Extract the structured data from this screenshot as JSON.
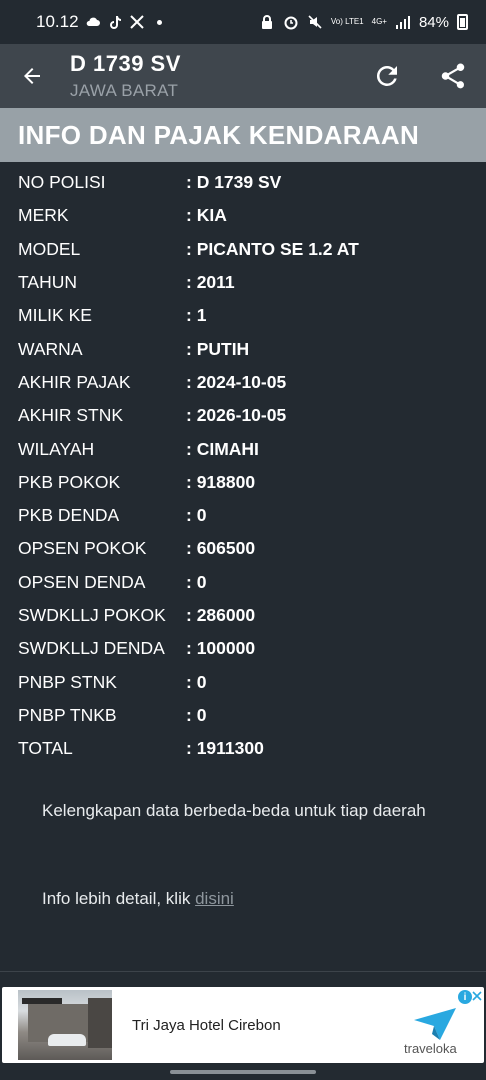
{
  "status_bar": {
    "time": "10.12",
    "battery": "84%",
    "network": "4G+",
    "volte": "Vo) LTE1"
  },
  "app_bar": {
    "title": "D 1739 SV",
    "subtitle": "JAWA BARAT"
  },
  "section": {
    "title": "INFO DAN PAJAK KENDARAAN"
  },
  "info_rows": [
    {
      "label": "NO POLISI",
      "value": ": D 1739 SV"
    },
    {
      "label": "MERK",
      "value": ": KIA"
    },
    {
      "label": "MODEL",
      "value": ": PICANTO SE 1.2 AT"
    },
    {
      "label": "TAHUN",
      "value": ": 2011"
    },
    {
      "label": "MILIK KE",
      "value": ": 1"
    },
    {
      "label": "WARNA",
      "value": ": PUTIH"
    },
    {
      "label": "AKHIR PAJAK",
      "value": ": 2024-10-05"
    },
    {
      "label": "AKHIR STNK",
      "value": ": 2026-10-05"
    },
    {
      "label": "WILAYAH",
      "value": ": CIMAHI"
    },
    {
      "label": "PKB POKOK",
      "value": ": 918800"
    },
    {
      "label": "PKB DENDA",
      "value": ": 0"
    },
    {
      "label": "OPSEN POKOK",
      "value": ": 606500"
    },
    {
      "label": "OPSEN DENDA",
      "value": ": 0"
    },
    {
      "label": "SWDKLLJ POKOK",
      "value": ": 286000"
    },
    {
      "label": "SWDKLLJ DENDA",
      "value": ": 100000"
    },
    {
      "label": "PNBP STNK",
      "value": ": 0"
    },
    {
      "label": "PNBP TNKB",
      "value": ": 0"
    },
    {
      "label": "TOTAL",
      "value": ": 1911300"
    }
  ],
  "notes": {
    "completeness": "Kelengkapan data berbeda-beda untuk tiap daerah",
    "detail_prefix": "Info lebih detail, klik ",
    "detail_link": "disini"
  },
  "ad": {
    "title": "Tri Jaya Hotel Cirebon",
    "brand": "traveloka",
    "info_mark": "i"
  },
  "colors": {
    "background": "#232a31",
    "app_bar": "#3f464d",
    "section_header": "#98a1a7",
    "accent_ad": "#29a8e0"
  }
}
